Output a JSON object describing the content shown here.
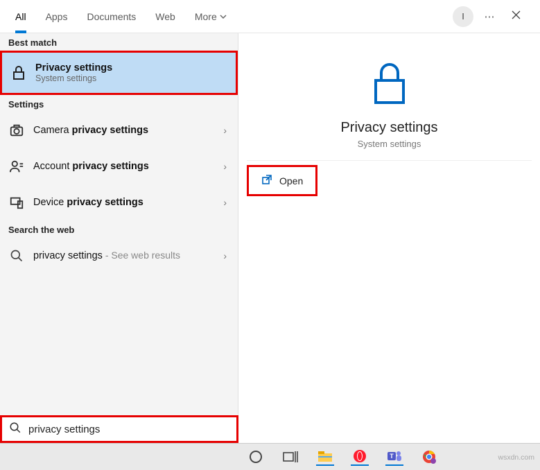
{
  "header": {
    "tabs": {
      "all": "All",
      "apps": "Apps",
      "documents": "Documents",
      "web": "Web",
      "more": "More"
    },
    "avatar_initial": "I"
  },
  "left": {
    "section_best_match": "Best match",
    "best_match": {
      "title": "Privacy settings",
      "subtitle": "System settings"
    },
    "section_settings": "Settings",
    "settings_items": {
      "camera": {
        "pre": "Camera ",
        "bold": "privacy settings"
      },
      "account": {
        "pre": "Account ",
        "bold": "privacy settings"
      },
      "device": {
        "pre": "Device ",
        "bold": "privacy settings"
      }
    },
    "section_web": "Search the web",
    "web_item": {
      "query": "privacy settings",
      "suffix": " - See web results"
    }
  },
  "right": {
    "title": "Privacy settings",
    "subtitle": "System settings",
    "open_label": "Open"
  },
  "search": {
    "value": "privacy settings"
  },
  "watermark": "wsxdn.com"
}
